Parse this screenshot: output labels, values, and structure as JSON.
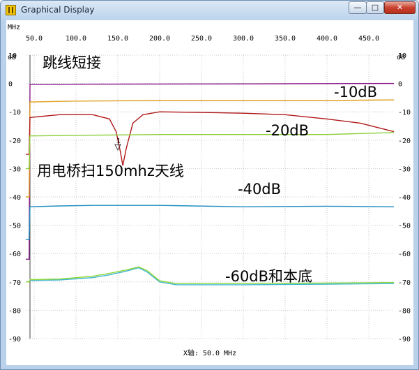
{
  "window": {
    "title": "Graphical Display",
    "minimize_glyph": "—",
    "maximize_glyph": "□",
    "close_glyph": "✕",
    "icon": "app-icon"
  },
  "plot": {
    "x_unit": "MHz",
    "y_unit": "dB",
    "x_ticks": [
      "50.0",
      "100.0",
      "150.0",
      "200.0",
      "250.0",
      "300.0",
      "350.0",
      "400.0",
      "450.0"
    ],
    "y_ticks": [
      "10",
      "0",
      "-10",
      "-20",
      "-30",
      "-40",
      "-50",
      "-60",
      "-70",
      "-80",
      "-90"
    ],
    "footer": "X轴: 50.0 MHz",
    "marker_label": "1",
    "annotations": {
      "short": "跳线短接",
      "minus10": "-10dB",
      "minus20": "-20dB",
      "bridge": "用电桥扫150mhz天线",
      "minus40": "-40dB",
      "minus60": "-60dB和本底"
    }
  },
  "chart_data": {
    "type": "line",
    "xlabel": "MHz",
    "ylabel": "dB",
    "xlim": [
      40,
      480
    ],
    "ylim": [
      -90,
      10
    ],
    "grid": true,
    "background": "#000000",
    "series": [
      {
        "name": "跳线短接",
        "color": "#8b1a8b",
        "x": [
          40,
          44,
          45,
          480
        ],
        "y": [
          -62,
          -62,
          -0.3,
          0
        ]
      },
      {
        "name": "-10dB",
        "color": "#e0a020",
        "x": [
          40,
          44,
          45,
          100,
          200,
          300,
          400,
          480
        ],
        "y": [
          -40,
          -40,
          -6.5,
          -6.2,
          -6,
          -6,
          -6,
          -5.8
        ]
      },
      {
        "name": "用电桥扫150mhz天线",
        "color": "#b01818",
        "x": [
          40,
          44,
          45,
          80,
          120,
          140,
          148,
          153,
          156,
          160,
          168,
          180,
          200,
          250,
          300,
          350,
          400,
          440,
          480
        ],
        "y": [
          -25,
          -25,
          -12,
          -11,
          -11,
          -12.5,
          -17,
          -24,
          -29,
          -23,
          -14,
          -11,
          -10,
          -10.2,
          -10.5,
          -11,
          -12.5,
          -14,
          -17
        ]
      },
      {
        "name": "-20dB",
        "color": "#8ccf3a",
        "x": [
          40,
          44,
          45,
          100,
          200,
          300,
          400,
          480
        ],
        "y": [
          -30,
          -30,
          -18.5,
          -18.3,
          -18,
          -18,
          -18,
          -17.3
        ]
      },
      {
        "name": "-40dB",
        "color": "#1f8fbf",
        "x": [
          40,
          44,
          45,
          80,
          120,
          200,
          300,
          400,
          480
        ],
        "y": [
          -55,
          -55,
          -43.5,
          -43.2,
          -43,
          -43,
          -43.5,
          -43.3,
          -43.5
        ]
      },
      {
        "name": "-60dB和本底",
        "color": "#3fb6cf",
        "x": [
          40,
          44,
          45,
          80,
          120,
          140,
          160,
          175,
          185,
          200,
          220,
          300,
          400,
          480
        ],
        "y": [
          -70,
          -70,
          -69.5,
          -69.3,
          -68.5,
          -67.5,
          -66.2,
          -65,
          -66.5,
          -70,
          -71,
          -71,
          -70.8,
          -70.6
        ]
      },
      {
        "name": "-60dB和本底",
        "color": "#8ed83a",
        "x": [
          40,
          44,
          45,
          80,
          120,
          140,
          160,
          175,
          185,
          200,
          220,
          300,
          400,
          480
        ],
        "y": [
          -70,
          -70,
          -69.2,
          -69,
          -68,
          -67,
          -65.8,
          -64.7,
          -66,
          -69.6,
          -70.6,
          -70.6,
          -70.4,
          -70.2
        ]
      }
    ],
    "markers": [
      {
        "label": "1",
        "x": 150,
        "y": -23.5
      }
    ]
  }
}
